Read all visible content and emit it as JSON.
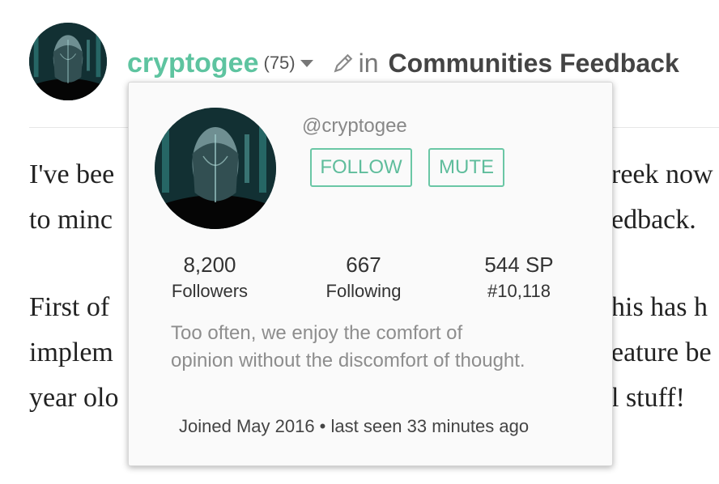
{
  "post": {
    "author": "cryptogee",
    "reputation": "(75)",
    "in_word": "in",
    "community": "Communities Feedback",
    "paragraphs": [
      [
        "I've bee",
        "to minc"
      ],
      [
        "First of",
        "implem",
        "year olo"
      ]
    ],
    "right_fragments": [
      [
        "reek now",
        "edback."
      ],
      [
        "his has h",
        "eature be",
        "l stuff!"
      ]
    ]
  },
  "profile_popup": {
    "handle": "@cryptogee",
    "follow_label": "FOLLOW",
    "mute_label": "MUTE",
    "stats": [
      {
        "value": "8,200",
        "label": "Followers"
      },
      {
        "value": "667",
        "label": "Following"
      },
      {
        "value": "544 SP",
        "label": "#10,118"
      }
    ],
    "about": "Too often, we enjoy the comfort of opinion without the discomfort of thought.",
    "joined": "Joined May 2016 • last seen 33 minutes ago"
  },
  "colors": {
    "accent": "#5ec4a0",
    "button_border": "#6ac7a5"
  },
  "icons": {
    "caret": "caret-down-icon",
    "pen": "pencil-icon"
  }
}
